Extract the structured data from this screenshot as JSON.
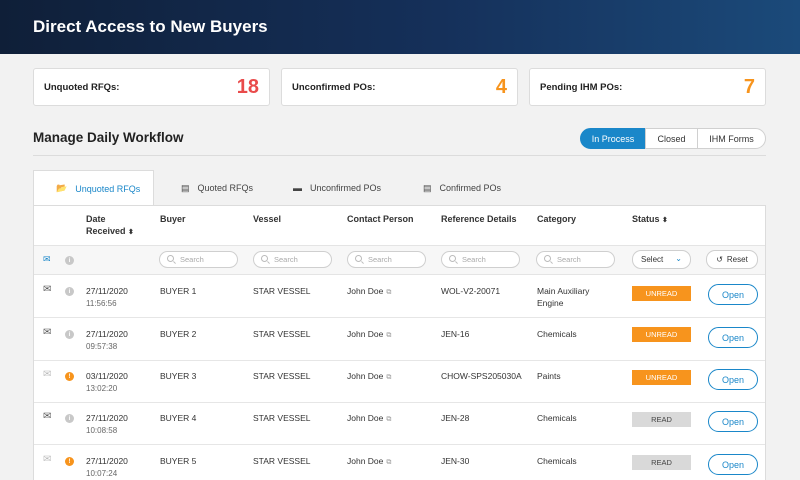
{
  "header": {
    "title": "Direct Access to New Buyers"
  },
  "stats": [
    {
      "label": "Unquoted RFQs:",
      "value": "18",
      "color": "#e94b4b"
    },
    {
      "label": "Unconfirmed POs:",
      "value": "4",
      "color": "#f7941d"
    },
    {
      "label": "Pending IHM POs:",
      "value": "7",
      "color": "#f7941d"
    }
  ],
  "workflow": {
    "title": "Manage Daily Workflow",
    "segments": [
      "In Process",
      "Closed",
      "IHM Forms"
    ]
  },
  "tabs": [
    {
      "label": "Unquoted RFQs",
      "icon": "folder-open-icon"
    },
    {
      "label": "Quoted RFQs",
      "icon": "document-icon"
    },
    {
      "label": "Unconfirmed POs",
      "icon": "folder-icon"
    },
    {
      "label": "Confirmed POs",
      "icon": "document-icon"
    }
  ],
  "columns": {
    "date": [
      "Date",
      "Received"
    ],
    "buyer": "Buyer",
    "vessel": "Vessel",
    "contact": "Contact Person",
    "reference": "Reference Details",
    "category": "Category",
    "status": "Status"
  },
  "filters": {
    "placeholder": "Search",
    "status_select": "Select",
    "reset_label": "Reset"
  },
  "rows": [
    {
      "date": "27/11/2020",
      "time": "11:56:56",
      "buyer": "BUYER 1",
      "vessel": "STAR VESSEL",
      "contact": "John Doe",
      "reference": "WOL-V2-20071",
      "category": [
        "Main Auxiliary",
        "Engine"
      ],
      "status": "UNREAD",
      "action": "Open"
    },
    {
      "date": "27/11/2020",
      "time": "09:57:38",
      "buyer": "BUYER 2",
      "vessel": "STAR VESSEL",
      "contact": "John Doe",
      "reference": "JEN-16",
      "category": [
        "Chemicals",
        ""
      ],
      "status": "UNREAD",
      "action": "Open"
    },
    {
      "date": "03/11/2020",
      "time": "13:02:20",
      "buyer": "BUYER 3",
      "vessel": "STAR VESSEL",
      "contact": "John Doe",
      "reference": "CHOW-SPS205030A",
      "category": [
        "Paints",
        ""
      ],
      "status": "UNREAD",
      "action": "Open"
    },
    {
      "date": "27/11/2020",
      "time": "10:08:58",
      "buyer": "BUYER 4",
      "vessel": "STAR VESSEL",
      "contact": "John Doe",
      "reference": "JEN-28",
      "category": [
        "Chemicals",
        ""
      ],
      "status": "READ",
      "action": "Open"
    },
    {
      "date": "27/11/2020",
      "time": "10:07:24",
      "buyer": "BUYER 5",
      "vessel": "STAR VESSEL",
      "contact": "John Doe",
      "reference": "JEN-30",
      "category": [
        "Chemicals",
        ""
      ],
      "status": "READ",
      "action": "Open"
    }
  ]
}
